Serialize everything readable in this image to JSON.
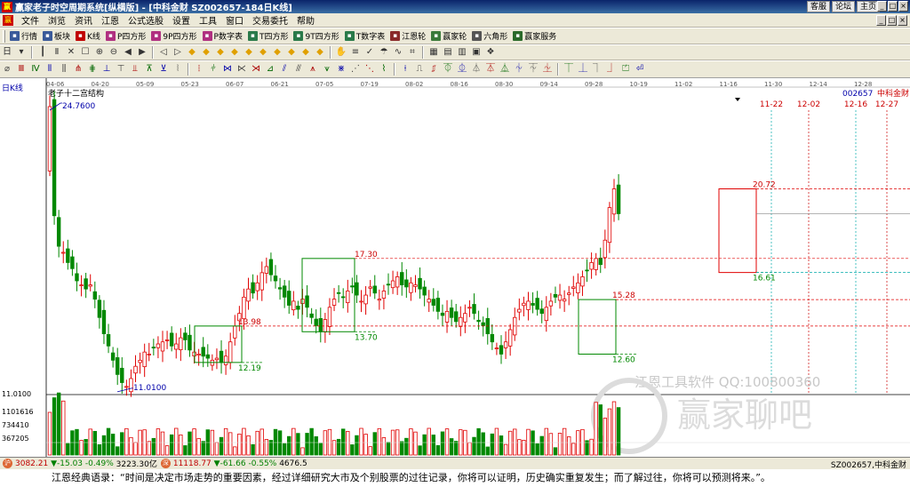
{
  "window": {
    "title": "赢家老子时空周期系统[纵横版] - [中科金财   SZ002657-184日K线]",
    "links": [
      "客服",
      "论坛",
      "主页"
    ],
    "controls": [
      "_",
      "□",
      "×"
    ]
  },
  "menu": {
    "items": [
      "文件",
      "浏览",
      "资讯",
      "江恩",
      "公式选股",
      "设置",
      "工具",
      "窗口",
      "交易委托",
      "帮助"
    ],
    "mdi_controls": [
      "_",
      "□",
      "×"
    ]
  },
  "toolbar": {
    "buttons": [
      {
        "label": "行情",
        "icon": "grid-icon",
        "color": "#3a5a9a"
      },
      {
        "label": "板块",
        "icon": "blocks-icon",
        "color": "#3a5a9a"
      },
      {
        "label": "K线",
        "icon": "candle-icon",
        "color": "#c00000"
      },
      {
        "label": "P四方形",
        "icon": "p-square-icon",
        "color": "#b03080"
      },
      {
        "label": "9P四方形",
        "icon": "9p-square-icon",
        "color": "#b03080"
      },
      {
        "label": "P数字表",
        "icon": "p-table-icon",
        "color": "#b03080"
      },
      {
        "label": "T四方形",
        "icon": "t-square-icon",
        "color": "#2a7a4a"
      },
      {
        "label": "9T四方形",
        "icon": "9t-square-icon",
        "color": "#2a7a4a"
      },
      {
        "label": "T数字表",
        "icon": "t-table-icon",
        "color": "#2a7a4a"
      },
      {
        "label": "江恩轮",
        "icon": "wheel-icon",
        "color": "#8a2a2a"
      },
      {
        "label": "赢家轮",
        "icon": "winner-wheel-icon",
        "color": "#3a7a3a"
      },
      {
        "label": "六角形",
        "icon": "hexagon-icon",
        "color": "#555555"
      },
      {
        "label": "赢家服务",
        "icon": "service-icon",
        "color": "#2a6a2a"
      }
    ]
  },
  "chart": {
    "panel_label": "日K线",
    "structure_label": "老子十二宫结构",
    "stock_code": "002657",
    "stock_name": "中科金财",
    "watermark_line1": "江恩工具软件  QQ:100800360",
    "watermark_line2": "赢家聊吧",
    "left_axis": {
      "top": "11.0100",
      "vol": [
        "1101616",
        "734410",
        "367205"
      ]
    },
    "date_ticks": [
      "04-06",
      "04-20",
      "05-09",
      "05-23",
      "06-07",
      "06-21",
      "07-05",
      "07-19",
      "08-02",
      "08-16",
      "08-30",
      "09-14",
      "09-28",
      "10-19",
      "11-02",
      "11-16",
      "11-30",
      "12-14",
      "12-28"
    ],
    "future_dates": [
      "11-22",
      "12-02",
      "12-16",
      "12-27"
    ],
    "annotations": [
      {
        "label": "24.7600",
        "kind": "high-marker"
      },
      {
        "label": "11.0100",
        "kind": "low-marker"
      },
      {
        "label": "13.98",
        "kind": "box-top"
      },
      {
        "label": "12.19",
        "kind": "box-bottom"
      },
      {
        "label": "17.30",
        "kind": "box-top"
      },
      {
        "label": "13.70",
        "kind": "box-bottom"
      },
      {
        "label": "15.28",
        "kind": "box-top"
      },
      {
        "label": "12.60",
        "kind": "box-bottom"
      },
      {
        "label": "20.72",
        "kind": "box-top"
      },
      {
        "label": "16.61",
        "kind": "box-bottom"
      }
    ],
    "colors": {
      "up": "#e00000",
      "down": "#008800",
      "dash": "#e00000",
      "box": "#008800",
      "box_red": "#e00000"
    }
  },
  "statusbar": {
    "sh_value": "3082.21",
    "sh_change": "▼-15.03",
    "sh_pct": "-0.49%",
    "sh_amount": "3223.30亿",
    "sz_value": "11118.77",
    "sz_change": "▼-61.66",
    "sz_pct": "-0.55%",
    "sz_amount": "4676.5",
    "right_code": "SZ002657,中科金财"
  },
  "quote": {
    "text": "江恩经典语录：“时间是决定市场走势的重要因素，经过详细研究大市及个别股票的过往记录，你将可以证明，历史确实重复发生；而了解过往，你将可以预测将来。”。"
  }
}
